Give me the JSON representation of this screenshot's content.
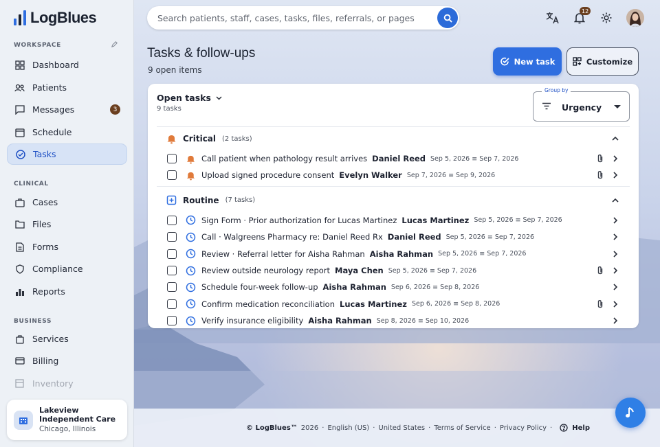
{
  "app": {
    "name": "LogBlues"
  },
  "sidebar": {
    "sections": [
      {
        "label": "WORKSPACE",
        "items": [
          {
            "label": "Dashboard",
            "icon": "grid-icon"
          },
          {
            "label": "Patients",
            "icon": "people-icon"
          },
          {
            "label": "Messages",
            "icon": "message-icon",
            "badge": "3"
          },
          {
            "label": "Schedule",
            "icon": "calendar-icon"
          },
          {
            "label": "Tasks",
            "icon": "check-circle-icon",
            "active": true
          }
        ]
      },
      {
        "label": "CLINICAL",
        "items": [
          {
            "label": "Cases",
            "icon": "briefcase-icon"
          },
          {
            "label": "Files",
            "icon": "folder-icon"
          },
          {
            "label": "Forms",
            "icon": "form-icon"
          },
          {
            "label": "Compliance",
            "icon": "shield-icon"
          },
          {
            "label": "Reports",
            "icon": "bar-chart-icon"
          }
        ]
      },
      {
        "label": "BUSINESS",
        "items": [
          {
            "label": "Services",
            "icon": "bag-icon"
          },
          {
            "label": "Billing",
            "icon": "card-icon"
          },
          {
            "label": "Inventory",
            "icon": "box-icon",
            "disabled": true
          }
        ]
      }
    ],
    "org": {
      "name": "Lakeview Independent Care",
      "location": "Chicago, Illinois"
    }
  },
  "topbar": {
    "search_placeholder": "Search patients, staff, cases, tasks, files, referrals, or pages",
    "notifications_count": "12"
  },
  "page": {
    "title": "Tasks & follow-ups",
    "subtitle": "9 open items",
    "new_task_label": "New task",
    "customize_label": "Customize"
  },
  "card": {
    "filter_label": "Open tasks",
    "filter_count": "9 tasks",
    "group_by_label": "Group by",
    "group_by_value": "Urgency",
    "groups": [
      {
        "name": "Critical",
        "count": "(2 tasks)",
        "color": "#e07a3a",
        "tasks": [
          {
            "title": "Call patient when pathology result arrives",
            "person": "Daniel Reed",
            "dates": "Sep 5, 2026 ≡ Sep 7, 2026",
            "attachment": true
          },
          {
            "title": "Upload signed procedure consent",
            "person": "Evelyn Walker",
            "dates": "Sep 7, 2026 ≡ Sep 9, 2026",
            "attachment": true
          }
        ]
      },
      {
        "name": "Routine",
        "count": "(7 tasks)",
        "color": "#2f6ee0",
        "tasks": [
          {
            "title": "Sign Form · Prior authorization for Lucas Martinez",
            "person": "Lucas Martinez",
            "dates": "Sep 5, 2026 ≡ Sep 7, 2026",
            "attachment": false
          },
          {
            "title": "Call · Walgreens Pharmacy re: Daniel Reed Rx",
            "person": "Daniel Reed",
            "dates": "Sep 5, 2026 ≡ Sep 7, 2026",
            "attachment": false
          },
          {
            "title": "Review · Referral letter for Aisha Rahman",
            "person": "Aisha Rahman",
            "dates": "Sep 5, 2026 ≡ Sep 7, 2026",
            "attachment": false
          },
          {
            "title": "Review outside neurology report",
            "person": "Maya Chen",
            "dates": "Sep 5, 2026 ≡ Sep 7, 2026",
            "attachment": true
          },
          {
            "title": "Schedule four-week follow-up",
            "person": "Aisha Rahman",
            "dates": "Sep 6, 2026 ≡ Sep 8, 2026",
            "attachment": false
          },
          {
            "title": "Confirm medication reconciliation",
            "person": "Lucas Martinez",
            "dates": "Sep 6, 2026 ≡ Sep 8, 2026",
            "attachment": true
          },
          {
            "title": "Verify insurance eligibility",
            "person": "Aisha Rahman",
            "dates": "Sep 8, 2026 ≡ Sep 10, 2026",
            "attachment": false
          }
        ]
      }
    ]
  },
  "footer": {
    "copyright": "© LogBlues™",
    "year": "2026",
    "links": [
      "English (US)",
      "United States",
      "Terms of Service",
      "Privacy Policy"
    ],
    "help_label": "Help"
  },
  "colors": {
    "accent": "#2f6ee0",
    "badge": "#6b3f1f",
    "active_bg": "#d7e3f6"
  }
}
